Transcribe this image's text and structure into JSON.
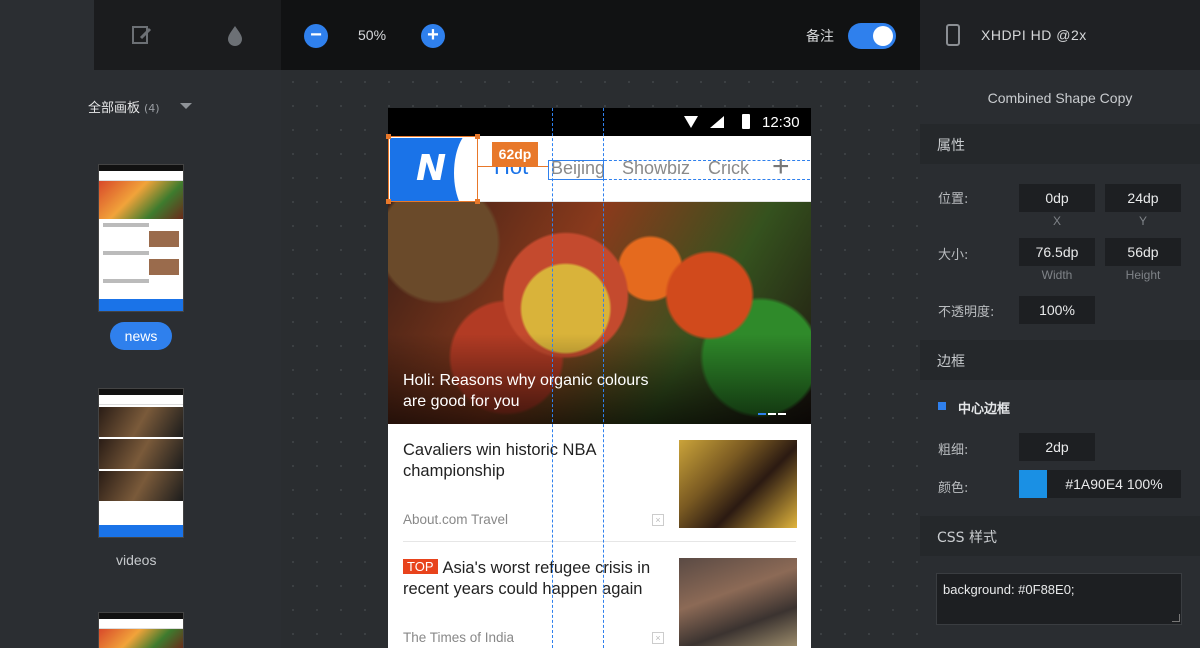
{
  "toolbar": {
    "zoom_out_label": "−",
    "zoom_level": "50%",
    "zoom_in_label": "+",
    "note_label": "备注",
    "note_toggle": "on",
    "device_label": "XHDPI HD @2x",
    "icons": [
      "edit-icon",
      "droplet-icon",
      "phone-icon"
    ],
    "accent_color": "#2F80ED"
  },
  "sidebar": {
    "group_title": "全部画板",
    "group_count": "(4)",
    "artboards": [
      {
        "label": "news",
        "selected": true
      },
      {
        "label": "videos",
        "selected": false
      }
    ]
  },
  "phone": {
    "status_time": "12:30",
    "logo_letter": "N",
    "tabs": [
      {
        "label": "Hot",
        "active": true
      },
      {
        "label": "Beijing",
        "active": false
      },
      {
        "label": "Showbiz",
        "active": false
      },
      {
        "label": "Crick",
        "active": false
      }
    ],
    "add_tab": "+",
    "hero": {
      "title": "Holi: Reasons why organic colours are good for you"
    },
    "articles": [
      {
        "title": "Cavaliers win historic NBA championship",
        "badge": "",
        "source": "About.com Travel"
      },
      {
        "title": "Asia's worst refugee crisis in recent years could happen again",
        "badge": "TOP",
        "source": "The Times of India"
      }
    ]
  },
  "overlay": {
    "dimension_badge": "62dp",
    "selection_color": "#E8782A"
  },
  "inspector": {
    "layer_name": "Combined Shape Copy",
    "sections": {
      "attributes": "属性",
      "border": "边框",
      "css": "CSS 样式"
    },
    "position": {
      "label": "位置:",
      "x": "0dp",
      "x_caption": "X",
      "y": "24dp",
      "y_caption": "Y"
    },
    "size": {
      "label": "大小:",
      "width": "76.5dp",
      "width_caption": "Width",
      "height": "56dp",
      "height_caption": "Height"
    },
    "opacity": {
      "label": "不透明度:",
      "value": "100%"
    },
    "border": {
      "name": "中心边框",
      "thickness_label": "粗细:",
      "thickness": "2dp",
      "color_label": "颜色:",
      "color_value": "#1A90E4 100%",
      "swatch": "#1A90E4"
    },
    "css_code": "background: #0F88E0;"
  }
}
